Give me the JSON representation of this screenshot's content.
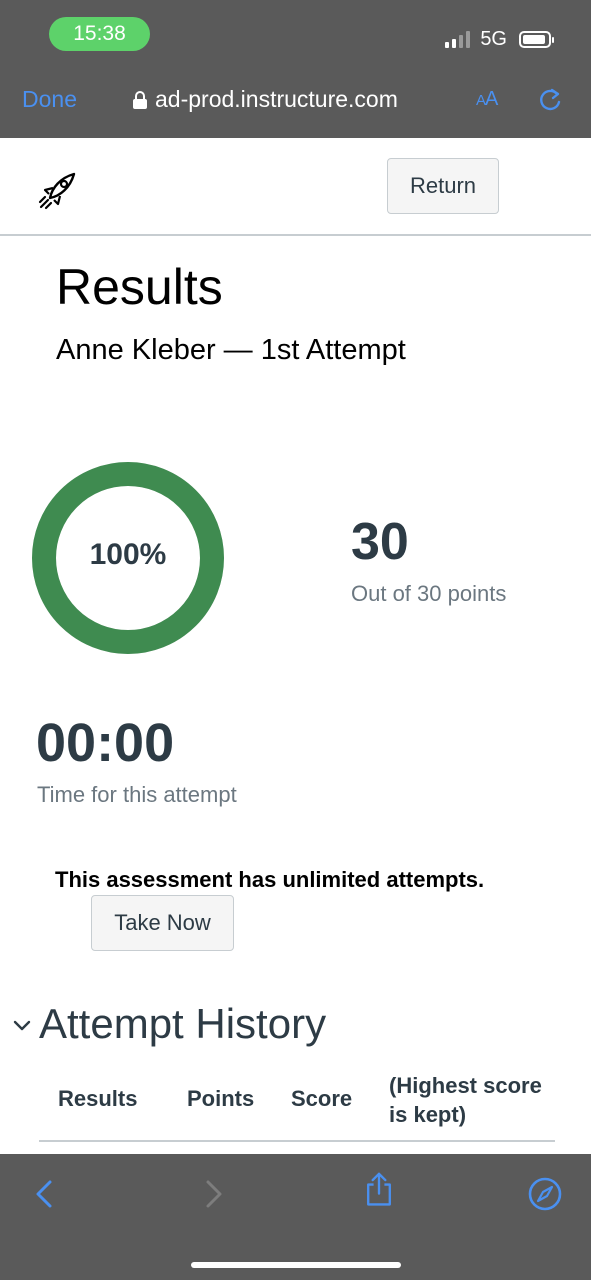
{
  "status_bar": {
    "time": "15:38",
    "network": "5G"
  },
  "browser": {
    "done_label": "Done",
    "url": "ad-prod.instructure.com",
    "text_size_label": "AA"
  },
  "header": {
    "return_label": "Return"
  },
  "results": {
    "title": "Results",
    "subtitle": "Anne Kleber — 1st Attempt",
    "percent_label": "100%",
    "percent_value": 1.0,
    "points": "30",
    "points_caption": "Out of 30 points",
    "time": "00:00",
    "time_caption": "Time for this attempt",
    "attempts_notice": "This assessment has unlimited attempts.",
    "take_now_label": "Take Now"
  },
  "attempt_history": {
    "title": "Attempt History",
    "columns": [
      "Results",
      "Points",
      "Score",
      "(Highest score is kept)"
    ]
  },
  "colors": {
    "ring": "#3f8b50",
    "chrome": "#5a5a5a",
    "link_blue": "#4a90f0",
    "text_dark": "#2d3b45",
    "time_pill": "#5dd26a"
  },
  "icons": [
    "lock-icon",
    "text-size-icon",
    "reload-icon",
    "rocket-icon",
    "chevron-down-icon",
    "back-icon",
    "forward-icon",
    "share-icon",
    "compass-icon",
    "signal-icon",
    "battery-icon"
  ]
}
